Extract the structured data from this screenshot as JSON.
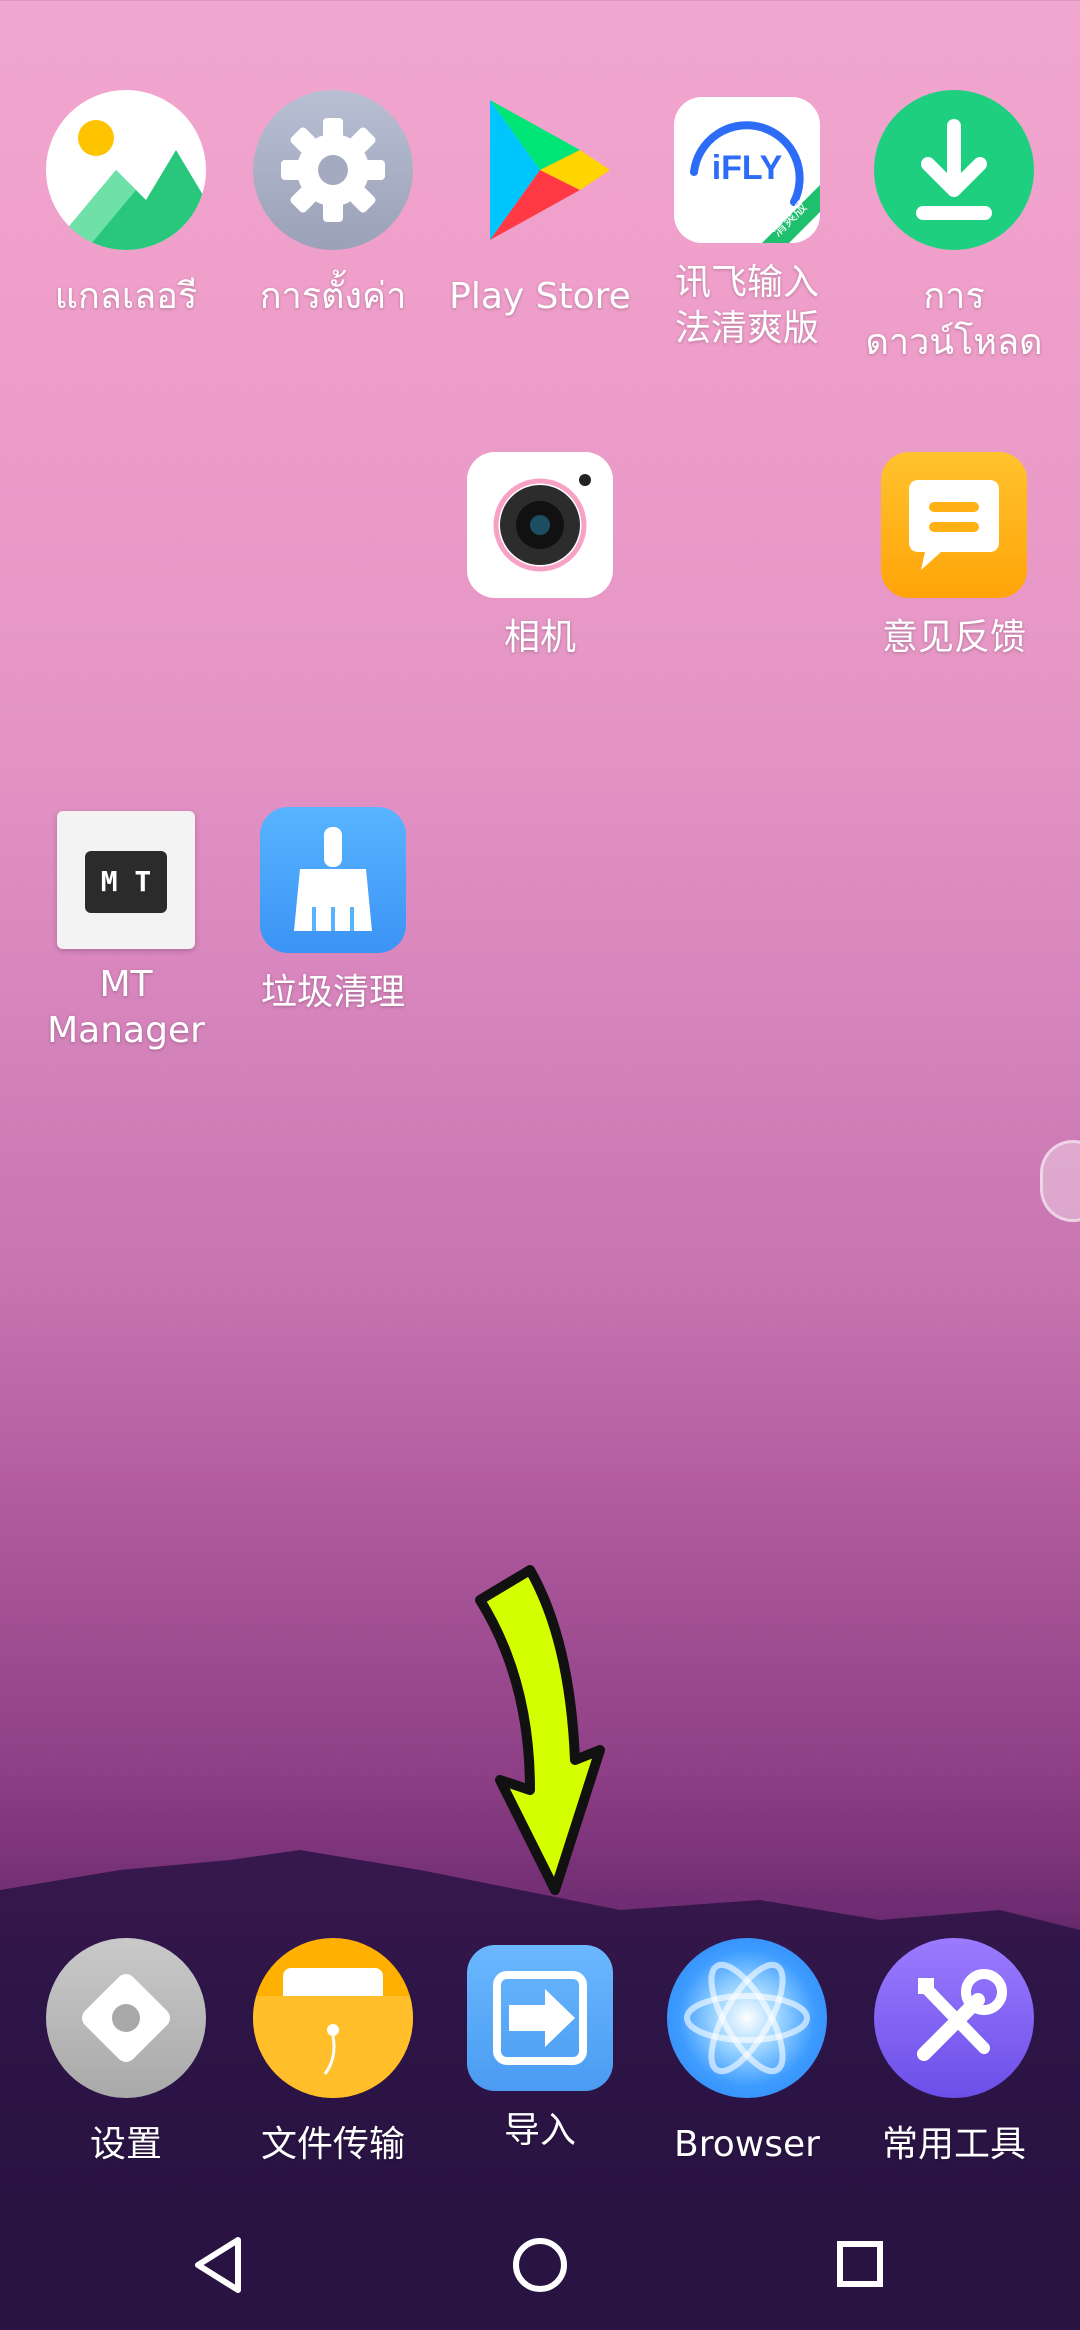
{
  "home": {
    "apps": [
      {
        "id": "gallery",
        "label": "แกลเลอรี",
        "icon": "gallery-icon"
      },
      {
        "id": "settings-th",
        "label": "การตั้งค่า",
        "icon": "gear-icon"
      },
      {
        "id": "playstore",
        "label": "Play Store",
        "icon": "play-store-icon"
      },
      {
        "id": "ifly",
        "label": "讯飞输入\n法清爽版",
        "icon": "ifly-icon",
        "icon_text": "iFLY",
        "badge_text": "清爽版"
      },
      {
        "id": "downloads",
        "label": "การ\nดาวน์โหลด",
        "icon": "download-icon"
      },
      {
        "id": "camera",
        "label": "相机",
        "icon": "camera-icon"
      },
      {
        "id": "feedback",
        "label": "意见反馈",
        "icon": "feedback-icon"
      },
      {
        "id": "mtmanager",
        "label": "MT\nManager",
        "icon": "mt-manager-icon",
        "icon_text": "M T"
      },
      {
        "id": "cleaner",
        "label": "垃圾清理",
        "icon": "broom-icon"
      }
    ]
  },
  "dock": {
    "apps": [
      {
        "id": "settings-cn",
        "label": "设置",
        "icon": "settings-diamond-icon"
      },
      {
        "id": "filetransfer",
        "label": "文件传输",
        "icon": "folder-icon"
      },
      {
        "id": "import",
        "label": "导入",
        "icon": "import-icon"
      },
      {
        "id": "browser",
        "label": "Browser",
        "icon": "browser-atom-icon"
      },
      {
        "id": "tools",
        "label": "常用工具",
        "icon": "tools-icon"
      }
    ]
  },
  "colors": {
    "arrow": "#d4ff00",
    "download_green": "#1fcf80",
    "feedback_yellow": "#ffb81c",
    "cleaner_blue": "#4aa8ff",
    "import_blue": "#5ab0ff",
    "tools_purple": "#7a5cff",
    "folder_orange": "#ffb000"
  },
  "navbar": {
    "buttons": [
      {
        "id": "back",
        "icon": "back-triangle-icon"
      },
      {
        "id": "home",
        "icon": "home-circle-icon"
      },
      {
        "id": "recents",
        "icon": "recents-square-icon"
      }
    ]
  }
}
